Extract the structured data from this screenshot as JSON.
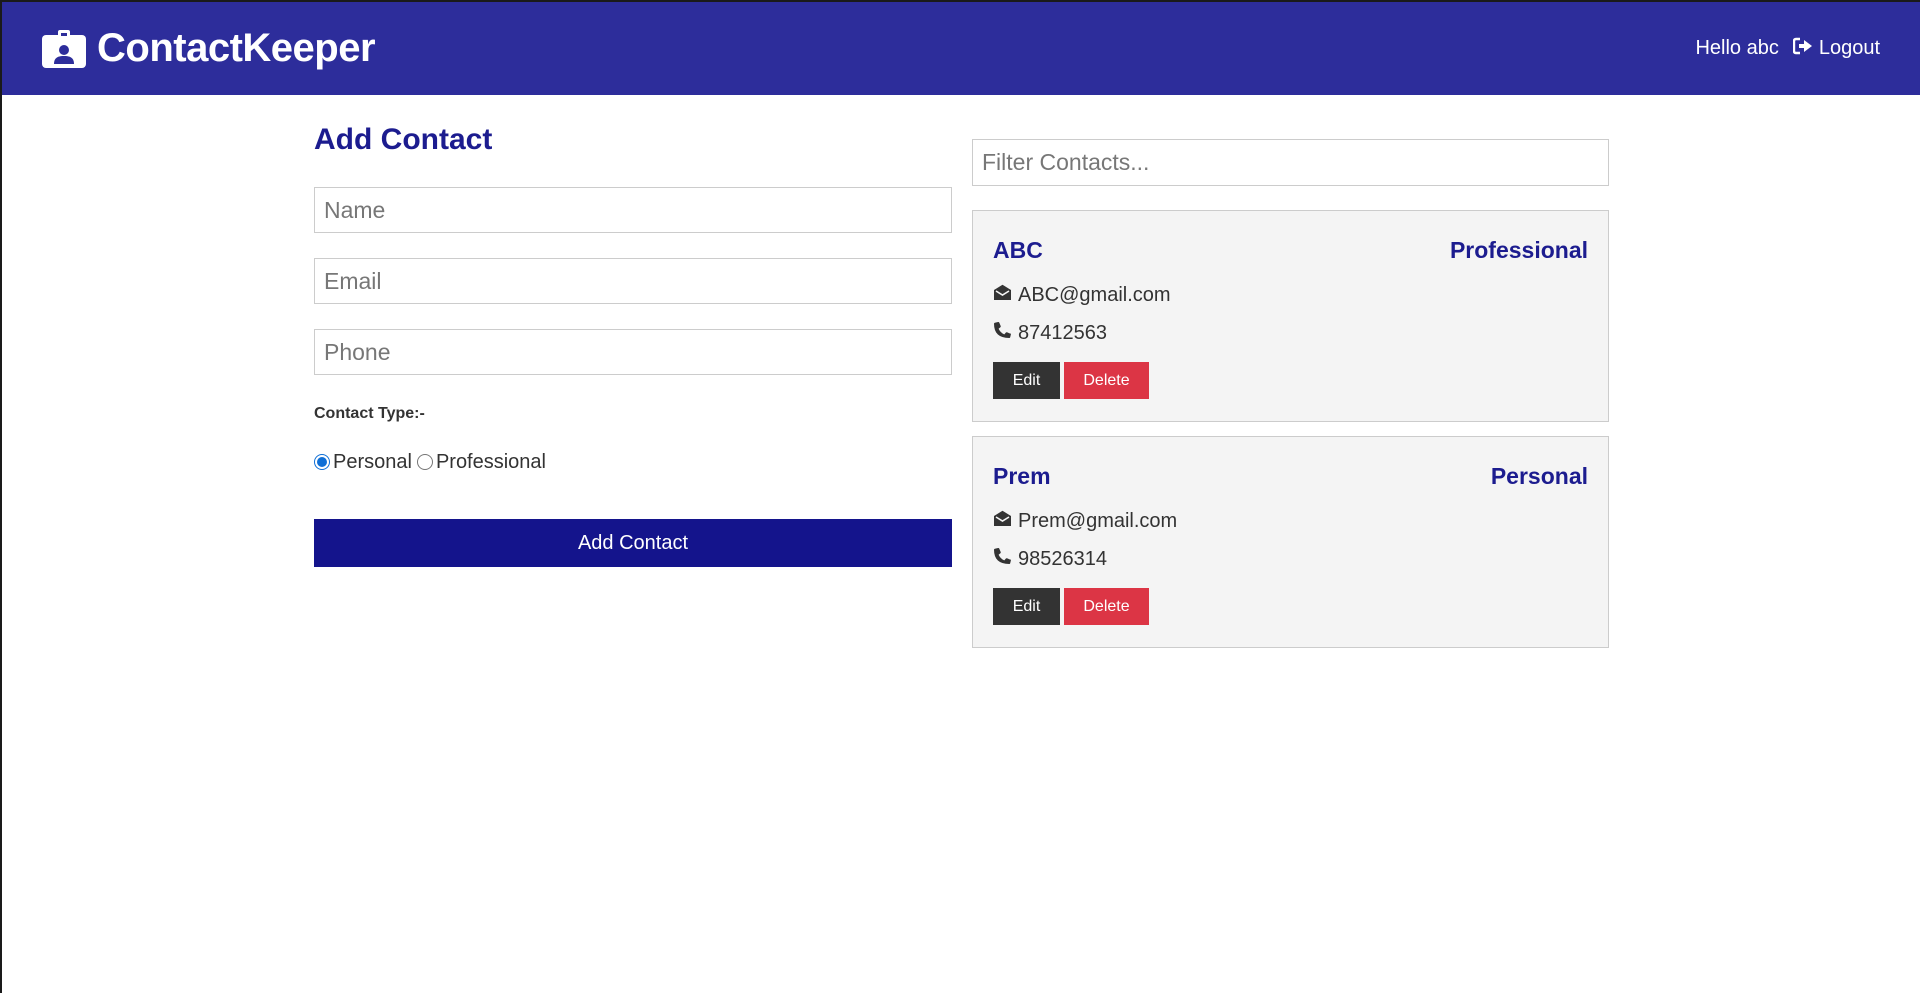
{
  "navbar": {
    "brand": "ContactKeeper",
    "greeting": "Hello abc",
    "logout_label": "Logout"
  },
  "form": {
    "title": "Add Contact",
    "name_placeholder": "Name",
    "email_placeholder": "Email",
    "phone_placeholder": "Phone",
    "type_label": "Contact Type:-",
    "type_options": [
      {
        "label": "Personal",
        "checked": true
      },
      {
        "label": "Professional",
        "checked": false
      }
    ],
    "submit_label": "Add Contact"
  },
  "filter": {
    "placeholder": "Filter Contacts..."
  },
  "contacts": [
    {
      "name": "ABC",
      "type": "Professional",
      "email": "ABC@gmail.com",
      "phone": "87412563",
      "edit_label": "Edit",
      "delete_label": "Delete"
    },
    {
      "name": "Prem",
      "type": "Personal",
      "email": "Prem@gmail.com",
      "phone": "98526314",
      "edit_label": "Edit",
      "delete_label": "Delete"
    }
  ],
  "colors": {
    "navbar": "#2d2d9b",
    "primary": "#14148c",
    "heading": "#1c1c8f",
    "dark": "#333333",
    "danger": "#dc3545",
    "card_bg": "#f4f4f4"
  },
  "icons": {
    "brand": "id-badge-icon",
    "logout": "sign-out-icon",
    "email": "envelope-open-icon",
    "phone": "phone-icon"
  }
}
